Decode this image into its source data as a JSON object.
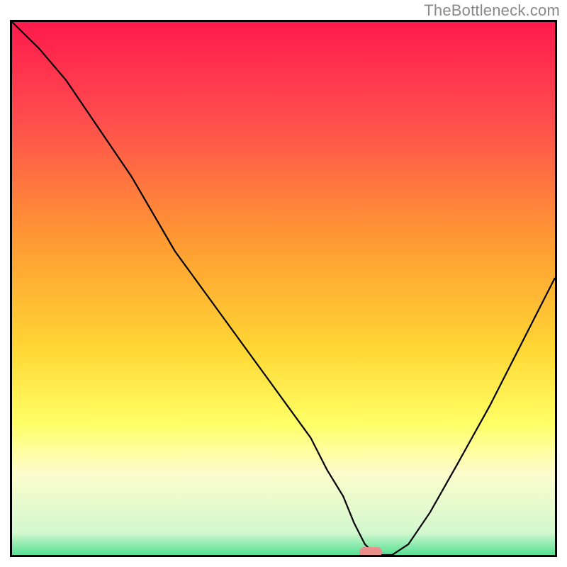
{
  "watermark": "TheBottleneck.com",
  "chart_data": {
    "type": "line",
    "title": "",
    "xlabel": "",
    "ylabel": "",
    "xlim": [
      0,
      100
    ],
    "ylim": [
      0,
      100
    ],
    "gradient_stops": [
      {
        "offset": 0,
        "color": "#ff1a4d"
      },
      {
        "offset": 18,
        "color": "#ff4d4d"
      },
      {
        "offset": 40,
        "color": "#ff9933"
      },
      {
        "offset": 60,
        "color": "#ffd633"
      },
      {
        "offset": 74,
        "color": "#ffff66"
      },
      {
        "offset": 83,
        "color": "#fdfccb"
      },
      {
        "offset": 94,
        "color": "#d3f8cf"
      },
      {
        "offset": 100,
        "color": "#1fd67a"
      }
    ],
    "series": [
      {
        "name": "bottleneck-curve",
        "color": "#000000",
        "x": [
          0,
          5,
          10,
          14,
          18,
          22,
          26,
          30,
          35,
          40,
          45,
          50,
          55,
          58,
          61,
          63,
          65,
          67,
          70,
          73,
          77,
          82,
          88,
          94,
          100
        ],
        "y": [
          100,
          95,
          89,
          83,
          77,
          71,
          64,
          57,
          50,
          43,
          36,
          29,
          22,
          16,
          11,
          6,
          2,
          0,
          0,
          2,
          8,
          17,
          28,
          40,
          52
        ]
      }
    ],
    "marker": {
      "x": 66,
      "y": 0.5,
      "color": "#eb8f8d"
    }
  }
}
